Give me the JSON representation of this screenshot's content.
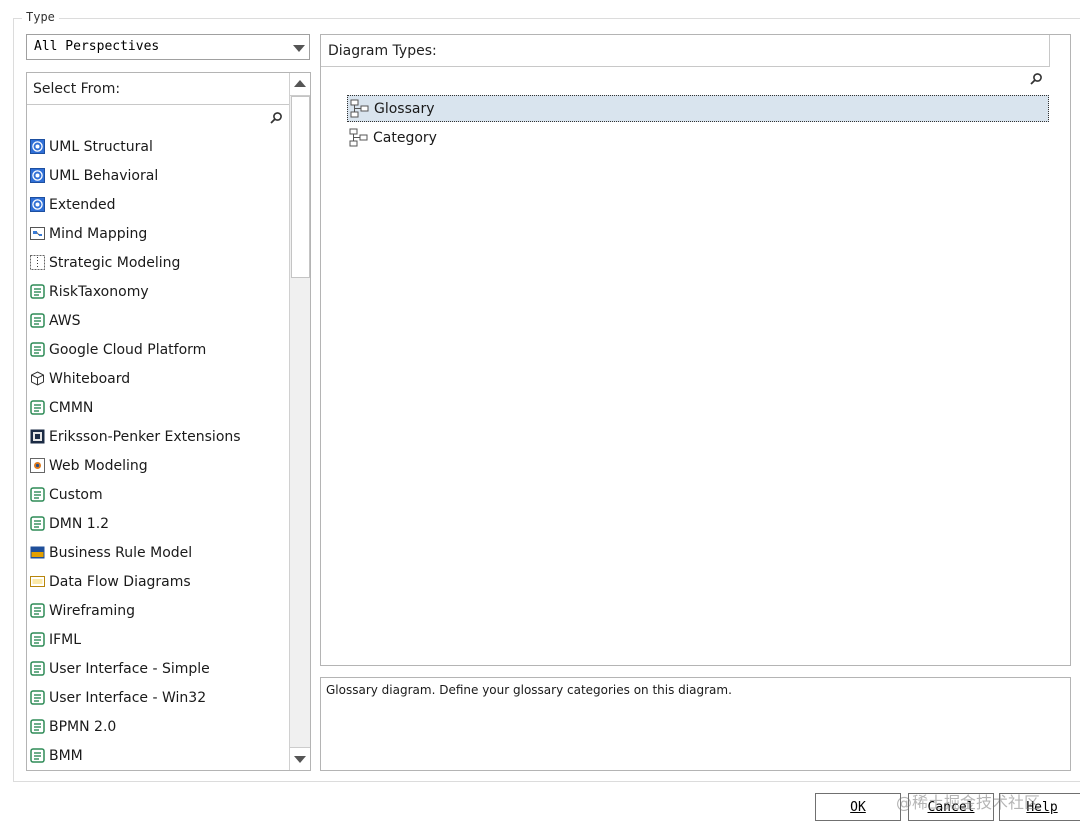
{
  "group_title": "Type",
  "perspective_select": {
    "value": "All Perspectives"
  },
  "left_panel": {
    "header": "Select From:",
    "items": [
      {
        "label": "UML Structural",
        "icon": "uml-icon"
      },
      {
        "label": "UML Behavioral",
        "icon": "uml-icon"
      },
      {
        "label": "Extended",
        "icon": "uml-icon"
      },
      {
        "label": "Mind Mapping",
        "icon": "mindmap-icon"
      },
      {
        "label": "Strategic Modeling",
        "icon": "strategic-icon"
      },
      {
        "label": "RiskTaxonomy",
        "icon": "mdg-icon"
      },
      {
        "label": "AWS",
        "icon": "mdg-icon"
      },
      {
        "label": "Google Cloud Platform",
        "icon": "mdg-icon"
      },
      {
        "label": "Whiteboard",
        "icon": "cube-icon"
      },
      {
        "label": "CMMN",
        "icon": "mdg-icon"
      },
      {
        "label": "Eriksson-Penker Extensions",
        "icon": "ep-icon"
      },
      {
        "label": "Web Modeling",
        "icon": "web-icon"
      },
      {
        "label": "Custom",
        "icon": "mdg-icon"
      },
      {
        "label": "DMN 1.2",
        "icon": "mdg-icon"
      },
      {
        "label": "Business Rule Model",
        "icon": "brm-icon"
      },
      {
        "label": "Data Flow Diagrams",
        "icon": "dfd-icon"
      },
      {
        "label": "Wireframing",
        "icon": "mdg-icon"
      },
      {
        "label": "IFML",
        "icon": "mdg-icon"
      },
      {
        "label": "User Interface - Simple",
        "icon": "mdg-icon"
      },
      {
        "label": "User Interface - Win32",
        "icon": "mdg-icon"
      },
      {
        "label": "BPMN 2.0",
        "icon": "mdg-icon"
      },
      {
        "label": "BMM",
        "icon": "mdg-icon"
      }
    ]
  },
  "right_panel": {
    "header": "Diagram Types:",
    "items": [
      {
        "label": "Glossary",
        "selected": true
      },
      {
        "label": "Category",
        "selected": false
      }
    ]
  },
  "description": "Glossary diagram. Define your glossary categories on this diagram.",
  "buttons": {
    "ok": "OK",
    "cancel": "Cancel",
    "help": "Help"
  },
  "watermark": "@稀土掘金技术社区"
}
